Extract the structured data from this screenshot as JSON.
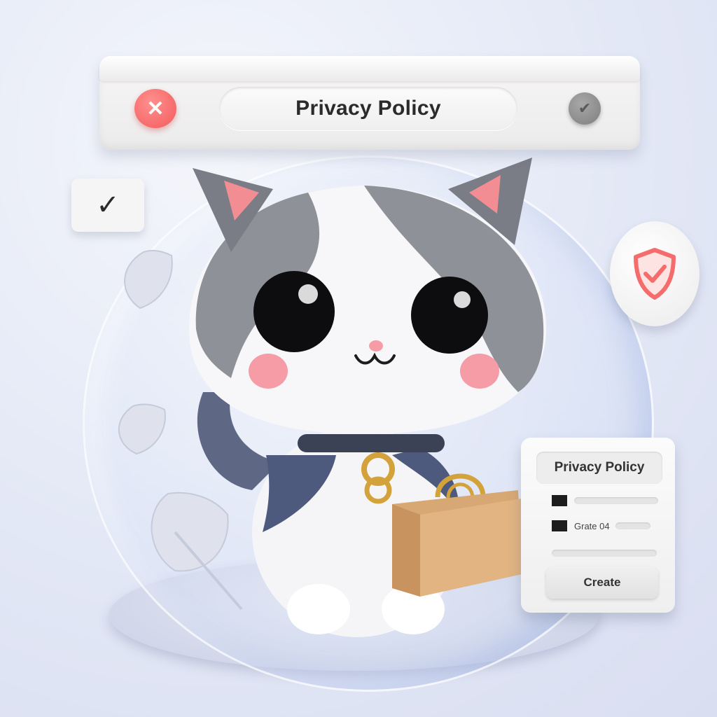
{
  "window": {
    "title": "Privacy Policy",
    "close_glyph": "✕",
    "confirm_glyph": "✔"
  },
  "check_card": {
    "glyph": "✓"
  },
  "policy_card": {
    "title": "Privacy Policy",
    "row_text": "Grate 04",
    "button_label": "Create"
  },
  "icons": {
    "close": "close-icon",
    "confirm": "check-circle-icon",
    "checkbox": "checkmark-icon",
    "shield": "shield-check-icon"
  },
  "colors": {
    "close_red": "#f35b5b",
    "shield_red": "#f56c6c",
    "cat_gray": "#8f9199",
    "cat_blue": "#4e5a7d",
    "box_tan": "#d8a874",
    "collar_gold": "#d4a23b"
  }
}
